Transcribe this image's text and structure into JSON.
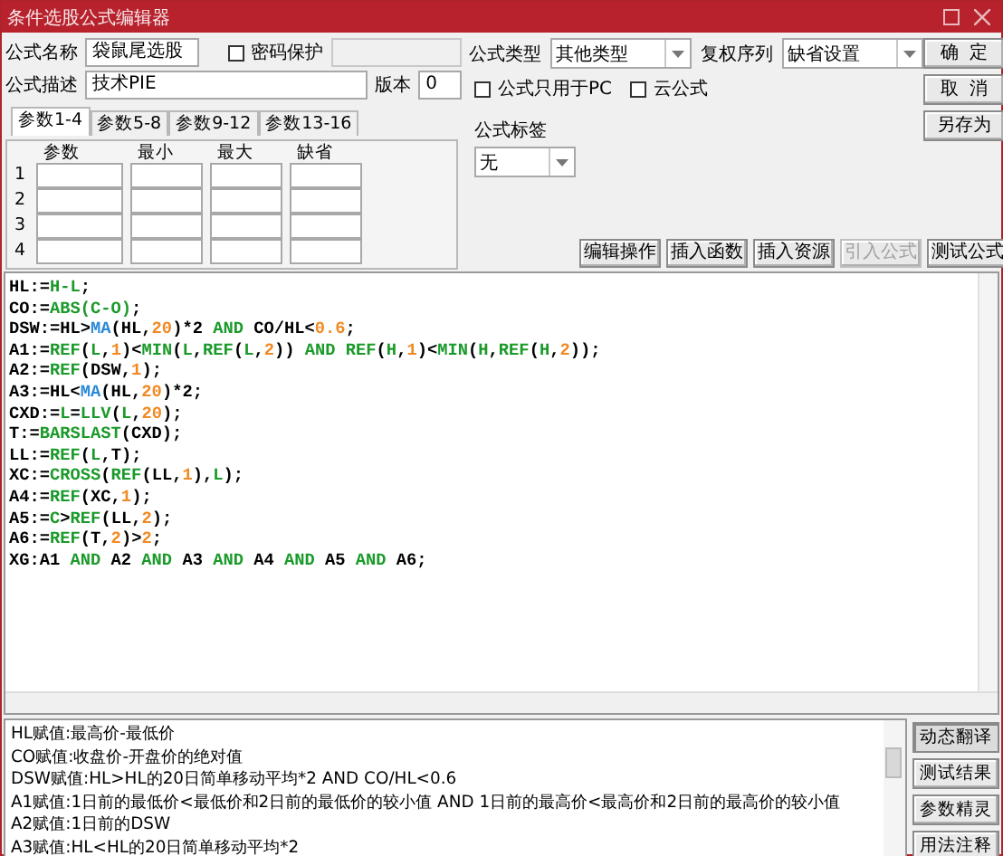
{
  "window": {
    "title": "条件选股公式编辑器"
  },
  "form": {
    "name_label": "公式名称",
    "name_value": "袋鼠尾选股",
    "password": {
      "label": "密码保护",
      "checked": false
    },
    "desc_label": "公式描述",
    "desc_value": "技术PIE",
    "version_label": "版本",
    "version_value": "0"
  },
  "param_tabs": [
    {
      "label": "参数1-4",
      "selected": true
    },
    {
      "label": "参数5-8",
      "selected": false
    },
    {
      "label": "参数9-12",
      "selected": false
    },
    {
      "label": "参数13-16",
      "selected": false
    }
  ],
  "param_table": {
    "columns": [
      "参数",
      "最小",
      "最大",
      "缺省"
    ],
    "rows": [
      "1",
      "2",
      "3",
      "4"
    ]
  },
  "formula_type": {
    "label": "公式类型",
    "value": "其他类型"
  },
  "rights_series": {
    "label": "复权序列",
    "value": "缺省设置"
  },
  "options": [
    {
      "label": "公式只用于PC",
      "checked": false
    },
    {
      "label": "云公式",
      "checked": false
    }
  ],
  "tag": {
    "label": "公式标签",
    "value": "无"
  },
  "side_buttons": [
    "确  定",
    "取  消",
    "另存为"
  ],
  "tool_buttons": [
    {
      "label": "编辑操作",
      "disabled": false
    },
    {
      "label": "插入函数",
      "disabled": false
    },
    {
      "label": "插入资源",
      "disabled": false
    },
    {
      "label": "引入公式",
      "disabled": true
    },
    {
      "label": "测试公式",
      "disabled": false
    }
  ],
  "code_lines": [
    [
      {
        "text": "HL:=",
        "kind": "plain"
      },
      {
        "text": "H-L",
        "kind": "function"
      },
      {
        "text": ";",
        "kind": "plain"
      }
    ],
    [
      {
        "text": "CO:=",
        "kind": "plain"
      },
      {
        "text": "ABS(C-O)",
        "kind": "function"
      },
      {
        "text": ";",
        "kind": "plain"
      }
    ],
    [
      {
        "text": "DSW:=HL>",
        "kind": "plain"
      },
      {
        "text": "MA",
        "kind": "indicator"
      },
      {
        "text": "(HL,",
        "kind": "plain"
      },
      {
        "text": "20",
        "kind": "number"
      },
      {
        "text": ")*2 ",
        "kind": "plain"
      },
      {
        "text": "AND",
        "kind": "function"
      },
      {
        "text": " CO/HL<",
        "kind": "plain"
      },
      {
        "text": "0.6",
        "kind": "number"
      },
      {
        "text": ";",
        "kind": "plain"
      }
    ],
    [
      {
        "text": "A1:=",
        "kind": "plain"
      },
      {
        "text": "REF",
        "kind": "function"
      },
      {
        "text": "(",
        "kind": "plain"
      },
      {
        "text": "L",
        "kind": "function"
      },
      {
        "text": ",",
        "kind": "plain"
      },
      {
        "text": "1",
        "kind": "number"
      },
      {
        "text": ")<",
        "kind": "plain"
      },
      {
        "text": "MIN",
        "kind": "function"
      },
      {
        "text": "(",
        "kind": "plain"
      },
      {
        "text": "L",
        "kind": "function"
      },
      {
        "text": ",",
        "kind": "plain"
      },
      {
        "text": "REF",
        "kind": "function"
      },
      {
        "text": "(",
        "kind": "plain"
      },
      {
        "text": "L",
        "kind": "function"
      },
      {
        "text": ",",
        "kind": "plain"
      },
      {
        "text": "2",
        "kind": "number"
      },
      {
        "text": ")) ",
        "kind": "plain"
      },
      {
        "text": "AND REF",
        "kind": "function"
      },
      {
        "text": "(",
        "kind": "plain"
      },
      {
        "text": "H",
        "kind": "function"
      },
      {
        "text": ",",
        "kind": "plain"
      },
      {
        "text": "1",
        "kind": "number"
      },
      {
        "text": ")<",
        "kind": "plain"
      },
      {
        "text": "MIN",
        "kind": "function"
      },
      {
        "text": "(",
        "kind": "plain"
      },
      {
        "text": "H",
        "kind": "function"
      },
      {
        "text": ",",
        "kind": "plain"
      },
      {
        "text": "REF",
        "kind": "function"
      },
      {
        "text": "(",
        "kind": "plain"
      },
      {
        "text": "H",
        "kind": "function"
      },
      {
        "text": ",",
        "kind": "plain"
      },
      {
        "text": "2",
        "kind": "number"
      },
      {
        "text": "));",
        "kind": "plain"
      }
    ],
    [
      {
        "text": "A2:=",
        "kind": "plain"
      },
      {
        "text": "REF",
        "kind": "function"
      },
      {
        "text": "(DSW,",
        "kind": "plain"
      },
      {
        "text": "1",
        "kind": "number"
      },
      {
        "text": ");",
        "kind": "plain"
      }
    ],
    [
      {
        "text": "A3:=HL<",
        "kind": "plain"
      },
      {
        "text": "MA",
        "kind": "indicator"
      },
      {
        "text": "(HL,",
        "kind": "plain"
      },
      {
        "text": "20",
        "kind": "number"
      },
      {
        "text": ")*2;",
        "kind": "plain"
      }
    ],
    [
      {
        "text": "CXD:=",
        "kind": "plain"
      },
      {
        "text": "L",
        "kind": "function"
      },
      {
        "text": "=",
        "kind": "plain"
      },
      {
        "text": "LLV",
        "kind": "function"
      },
      {
        "text": "(",
        "kind": "plain"
      },
      {
        "text": "L",
        "kind": "function"
      },
      {
        "text": ",",
        "kind": "plain"
      },
      {
        "text": "20",
        "kind": "number"
      },
      {
        "text": ");",
        "kind": "plain"
      }
    ],
    [
      {
        "text": "T:=",
        "kind": "plain"
      },
      {
        "text": "BARSLAST",
        "kind": "function"
      },
      {
        "text": "(CXD);",
        "kind": "plain"
      }
    ],
    [
      {
        "text": "LL:=",
        "kind": "plain"
      },
      {
        "text": "REF",
        "kind": "function"
      },
      {
        "text": "(",
        "kind": "plain"
      },
      {
        "text": "L",
        "kind": "function"
      },
      {
        "text": ",T);",
        "kind": "plain"
      }
    ],
    [
      {
        "text": "XC:=",
        "kind": "plain"
      },
      {
        "text": "CROSS",
        "kind": "function"
      },
      {
        "text": "(",
        "kind": "plain"
      },
      {
        "text": "REF",
        "kind": "function"
      },
      {
        "text": "(LL,",
        "kind": "plain"
      },
      {
        "text": "1",
        "kind": "number"
      },
      {
        "text": "),",
        "kind": "plain"
      },
      {
        "text": "L",
        "kind": "function"
      },
      {
        "text": ");",
        "kind": "plain"
      }
    ],
    [
      {
        "text": "A4:=",
        "kind": "plain"
      },
      {
        "text": "REF",
        "kind": "function"
      },
      {
        "text": "(XC,",
        "kind": "plain"
      },
      {
        "text": "1",
        "kind": "number"
      },
      {
        "text": ");",
        "kind": "plain"
      }
    ],
    [
      {
        "text": "A5:=",
        "kind": "plain"
      },
      {
        "text": "C",
        "kind": "function"
      },
      {
        "text": ">",
        "kind": "plain"
      },
      {
        "text": "REF",
        "kind": "function"
      },
      {
        "text": "(LL,",
        "kind": "plain"
      },
      {
        "text": "2",
        "kind": "number"
      },
      {
        "text": ");",
        "kind": "plain"
      }
    ],
    [
      {
        "text": "A6:=",
        "kind": "plain"
      },
      {
        "text": "REF",
        "kind": "function"
      },
      {
        "text": "(T,",
        "kind": "plain"
      },
      {
        "text": "2",
        "kind": "number"
      },
      {
        "text": ")>",
        "kind": "plain"
      },
      {
        "text": "2",
        "kind": "number"
      },
      {
        "text": ";",
        "kind": "plain"
      }
    ],
    [
      {
        "text": "XG:A1 ",
        "kind": "plain"
      },
      {
        "text": "AND",
        "kind": "function"
      },
      {
        "text": " A2 ",
        "kind": "plain"
      },
      {
        "text": "AND",
        "kind": "function"
      },
      {
        "text": " A3 ",
        "kind": "plain"
      },
      {
        "text": "AND",
        "kind": "function"
      },
      {
        "text": " A4 ",
        "kind": "plain"
      },
      {
        "text": "AND",
        "kind": "function"
      },
      {
        "text": " A5 ",
        "kind": "plain"
      },
      {
        "text": "AND",
        "kind": "function"
      },
      {
        "text": " A6;",
        "kind": "plain"
      }
    ]
  ],
  "description_lines": [
    "HL赋值:最高价-最低价",
    "CO赋值:收盘价-开盘价的绝对值",
    "DSW赋值:HL>HL的20日简单移动平均*2 AND CO/HL<0.6",
    "A1赋值:1日前的最低价<最低价和2日前的最低价的较小值 AND 1日前的最高价<最高价和2日前的最高价的较小值",
    "A2赋值:1日前的DSW",
    "A3赋值:HL<HL的20日简单移动平均*2"
  ],
  "bottom_buttons": [
    {
      "label": "动态翻译",
      "selected": true
    },
    {
      "label": "测试结果",
      "selected": false
    },
    {
      "label": "参数精灵",
      "selected": false
    },
    {
      "label": "用法注释",
      "selected": false
    }
  ]
}
